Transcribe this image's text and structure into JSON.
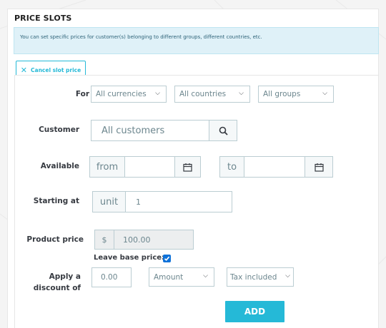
{
  "section": {
    "title": "PRICE SLOTS",
    "info": "You can set specific prices for customer(s) belonging to different groups, different countries, etc."
  },
  "cancel_button": {
    "icon": "close-icon",
    "label": "Cancel slot price"
  },
  "form": {
    "for": {
      "label": "For",
      "currency": "All currencies",
      "country": "All countries",
      "group": "All groups"
    },
    "customer": {
      "label": "Customer",
      "placeholder": "All customers",
      "icon": "search-icon"
    },
    "available": {
      "label": "Available",
      "from_label": "from",
      "to_label": "to",
      "icon": "calendar-icon"
    },
    "starting_at": {
      "label": "Starting at",
      "unit_label": "unit",
      "value": "1"
    },
    "product_price": {
      "label": "Product price",
      "currency_symbol": "$",
      "value": "100.00",
      "leave_base_label": "Leave base price:",
      "leave_base_checked": true
    },
    "discount": {
      "label_line1": "Apply a",
      "label_line2": "discount of",
      "value": "0.00",
      "type": "Amount",
      "tax": "Tax included"
    },
    "add_button": "ADD"
  },
  "colors": {
    "accent": "#25b9d7",
    "info_bg": "#dff1f8",
    "checkbox": "#0f72d9"
  }
}
